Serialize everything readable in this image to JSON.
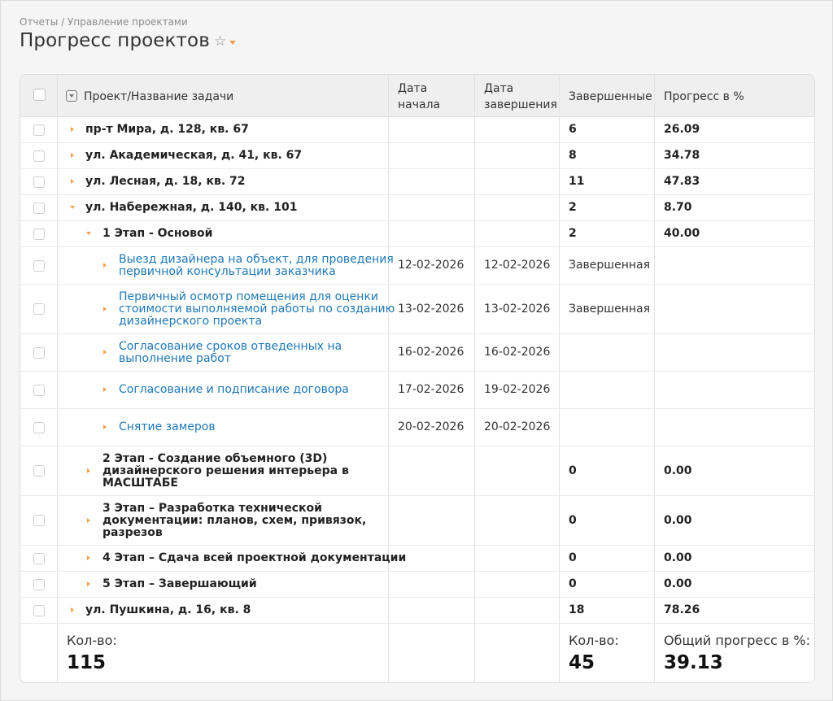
{
  "breadcrumb": "Отчеты / Управление проектами",
  "page_title": "Прогресс проектов",
  "icons": {
    "star": "star-outline-icon",
    "menu": "caret-down-icon",
    "filter": "filter-icon",
    "expand": "triangle-right-icon",
    "collapse": "triangle-down-icon"
  },
  "colors": {
    "accent": "#f0a04b",
    "link": "#1f77b4"
  },
  "columns": {
    "name": "Проект/Название задачи",
    "start_1": "Дата",
    "start_2": "начала",
    "end_1": "Дата",
    "end_2": "завершения",
    "done": "Завершенные",
    "progress": "Прогресс в %"
  },
  "rows": [
    {
      "name": "пр-т Мира, д. 128, кв. 67",
      "done": "6",
      "progress": "26.09"
    },
    {
      "name": "ул. Академическая, д. 41, кв. 67",
      "done": "8",
      "progress": "34.78"
    },
    {
      "name": "ул. Лесная, д. 18, кв. 72",
      "done": "11",
      "progress": "47.83"
    },
    {
      "name": "ул. Набережная, д. 140, кв. 101",
      "done": "2",
      "progress": "8.70"
    },
    {
      "name": "1 Этап - Основой",
      "done": "2",
      "progress": "40.00"
    },
    {
      "name_1": "Выезд дизайнера на объект, для проведения",
      "name_2": "первичной консультации заказчика",
      "start": "12-02-2026",
      "end": "12-02-2026",
      "done": "Завершенная"
    },
    {
      "name_1": "Первичный осмотр помещения для оценки",
      "name_2": "стоимости выполняемой работы по созданию",
      "name_3": "дизайнерского проекта",
      "start": "13-02-2026",
      "end": "13-02-2026",
      "done": "Завершенная"
    },
    {
      "name_1": "Согласование сроков отведенных на",
      "name_2": "выполнение работ",
      "start": "16-02-2026",
      "end": "16-02-2026"
    },
    {
      "name": "Согласование и подписание договора",
      "start": "17-02-2026",
      "end": "19-02-2026"
    },
    {
      "name": "Снятие замеров",
      "start": "20-02-2026",
      "end": "20-02-2026"
    },
    {
      "name_1": "2 Этап - Создание объемного (3D)",
      "name_2": "дизайнерского решения интерьера в",
      "name_3": "МАСШТАБЕ",
      "done": "0",
      "progress": "0.00"
    },
    {
      "name_1": "3 Этап – Разработка технической",
      "name_2": "документации: планов, схем, привязок,",
      "name_3": "разрезов",
      "done": "0",
      "progress": "0.00"
    },
    {
      "name": "4 Этап – Сдача всей проектной документации",
      "done": "0",
      "progress": "0.00"
    },
    {
      "name": "5 Этап – Завершающий",
      "done": "0",
      "progress": "0.00"
    },
    {
      "name": "ул. Пушкина, д. 16, кв. 8",
      "done": "18",
      "progress": "78.26"
    }
  ],
  "footer": {
    "count_label": "Кол-во:",
    "count_value": "115",
    "done_label": "Кол-во:",
    "done_value": "45",
    "progress_label": "Общий прогресс в %:",
    "progress_value": "39.13"
  }
}
